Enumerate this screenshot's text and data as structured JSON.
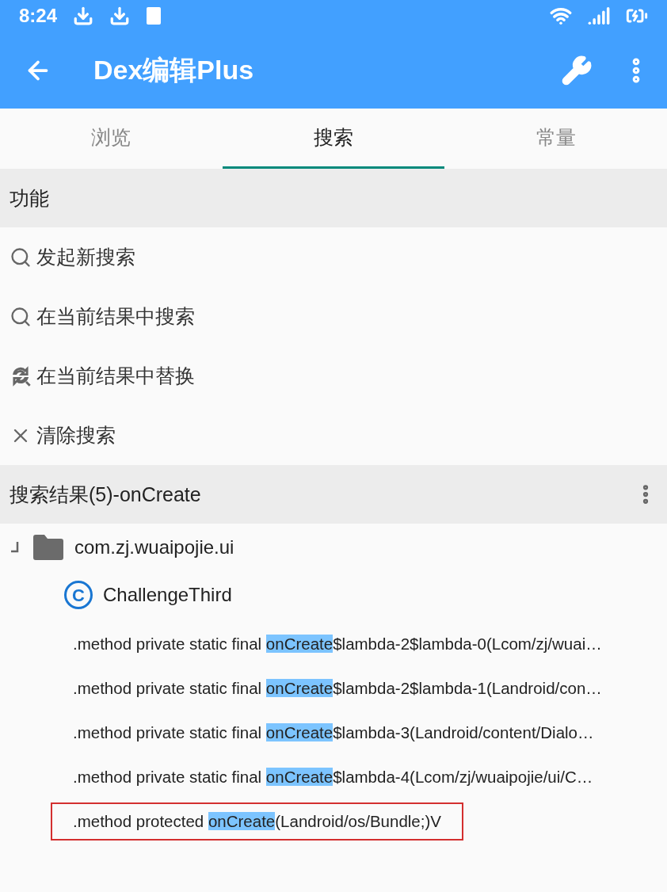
{
  "status_bar": {
    "time": "8:24"
  },
  "app_bar": {
    "title": "Dex编辑Plus"
  },
  "tabs": [
    {
      "label": "浏览",
      "selected": false
    },
    {
      "label": "搜索",
      "selected": true
    },
    {
      "label": "常量",
      "selected": false
    }
  ],
  "functions": {
    "header": "功能",
    "items": [
      {
        "kind": "search",
        "label": "发起新搜索"
      },
      {
        "kind": "search",
        "label": "在当前结果中搜索"
      },
      {
        "kind": "replace",
        "label": "在当前结果中替换"
      },
      {
        "kind": "clear",
        "label": "清除搜索"
      }
    ]
  },
  "results": {
    "header": "搜索结果(5)-onCreate",
    "tree": [
      {
        "kind": "package",
        "label": "com.zj.wuaipojie.ui",
        "expanded": true,
        "children": [
          {
            "kind": "class",
            "badge": "C",
            "label": "ChallengeThird",
            "children": [
              {
                "kind": "method",
                "before": ".method private static final ",
                "match": "onCreate",
                "after": "$lambda-2$lambda-0(Lcom/zj/wuai…",
                "outlined": false
              },
              {
                "kind": "method",
                "before": ".method private static final ",
                "match": "onCreate",
                "after": "$lambda-2$lambda-1(Landroid/con…",
                "outlined": false
              },
              {
                "kind": "method",
                "before": ".method private static final ",
                "match": "onCreate",
                "after": "$lambda-3(Landroid/content/Dialo…",
                "outlined": false
              },
              {
                "kind": "method",
                "before": ".method private static final ",
                "match": "onCreate",
                "after": "$lambda-4(Lcom/zj/wuaipojie/ui/C…",
                "outlined": false
              },
              {
                "kind": "method",
                "before": ".method protected ",
                "match": "onCreate",
                "after": "(Landroid/os/Bundle;)V",
                "outlined": true
              }
            ]
          }
        ]
      }
    ]
  }
}
